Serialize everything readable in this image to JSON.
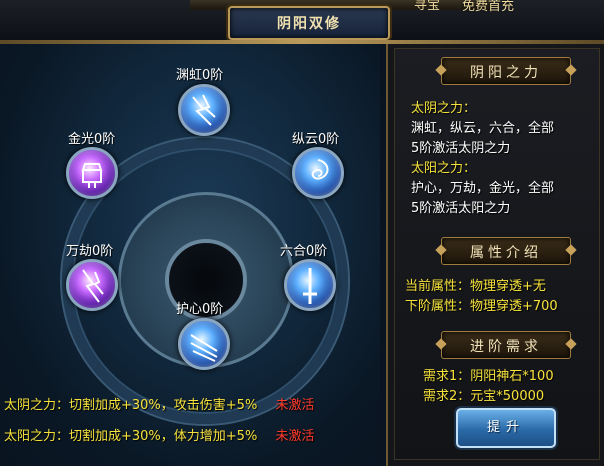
{
  "header": {
    "title": "阴阳双修",
    "top_free_label": "免费首充",
    "top_partial_label": "寻宝"
  },
  "nodes": [
    {
      "id": "yuanhong",
      "label": "渊虹0阶",
      "gem": "blue-lightning-gem",
      "color": "blue"
    },
    {
      "id": "zongyun",
      "label": "纵云0阶",
      "gem": "blue-vortex-gem",
      "color": "blue"
    },
    {
      "id": "liuhe",
      "label": "六合0阶",
      "gem": "blue-sword-gem",
      "color": "blue"
    },
    {
      "id": "huxin",
      "label": "护心0阶",
      "gem": "blue-arrows-gem",
      "color": "blue"
    },
    {
      "id": "wanjie",
      "label": "万劫0阶",
      "gem": "purple-lightning-gem",
      "color": "purple"
    },
    {
      "id": "jinguang",
      "label": "金光0阶",
      "gem": "purple-lantern-gem",
      "color": "purple"
    }
  ],
  "bonuses": [
    {
      "text": "太阴之力：切割加成+30%，攻击伤害+5%",
      "status": "未激活"
    },
    {
      "text": "太阳之力：切割加成+30%，体力增加+5%",
      "status": "未激活"
    }
  ],
  "right": {
    "yinyang_title": "阴阳之力",
    "taiyin_label": "太阴之力：",
    "taiyin_line1": "渊虹，纵云，六合，全部",
    "taiyin_line2": "5阶激活太阴之力",
    "taiyang_label": "太阳之力：",
    "taiyang_line1": "护心，万劫，金光，全部",
    "taiyang_line2": "5阶激活太阳之力",
    "attr_title": "属性介绍",
    "current_attr": "当前属性：物理穿透+无",
    "next_attr": "下阶属性：物理穿透+700",
    "req_title": "进阶需求",
    "req1": "需求1：阴阳神石*100",
    "req2": "需求2：元宝*50000"
  },
  "promote_button": "提升",
  "colors": {
    "yellow": "#f6e23c",
    "red": "#ff3a2a",
    "gold": "#b99a5a"
  }
}
